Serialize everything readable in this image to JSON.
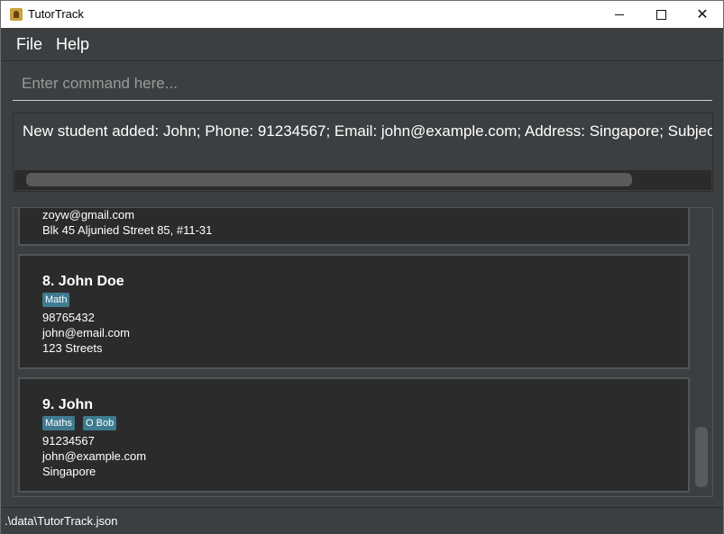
{
  "window": {
    "title": "TutorTrack",
    "controls": {
      "minimize": "",
      "maximize": "",
      "close": "✕"
    }
  },
  "menu": {
    "items": [
      {
        "label": "File"
      },
      {
        "label": "Help"
      }
    ]
  },
  "command": {
    "placeholder": "Enter command here...",
    "value": ""
  },
  "result": {
    "text": "New student added: John; Phone: 91234567; Email: john@example.com; Address: Singapore; Subjects: Ma"
  },
  "students": [
    {
      "email_partial": "zoyw@gmail.com",
      "address": "Blk 45 Aljunied Street 85, #11-31"
    },
    {
      "name": "8. John Doe",
      "tags": [
        "Math"
      ],
      "phone": "98765432",
      "email": "john@email.com",
      "address": "123 Streets"
    },
    {
      "name": "9. John",
      "tags": [
        "Maths",
        "O Bob"
      ],
      "phone": "91234567",
      "email": "john@example.com",
      "address": "Singapore"
    }
  ],
  "status": {
    "path": ".\\data\\TutorTrack.json"
  },
  "colors": {
    "background": "#3c3f41",
    "card": "#2b2b2b",
    "tag": "#3e7b91"
  }
}
